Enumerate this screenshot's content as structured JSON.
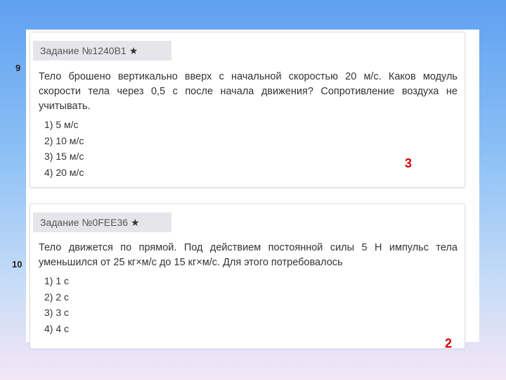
{
  "slide": {
    "question_numbers": [
      "9",
      "10"
    ],
    "answers": [
      "3",
      "2"
    ]
  },
  "tasks": [
    {
      "header": "Задание №1240B1",
      "star": "★",
      "text": "Тело брошено вертикально вверх с начальной скоростью 20 м/с. Каков модуль скорости тела через 0,5 с после начала движения? Сопротивление воздуха не учитывать.",
      "options": [
        "1) 5 м/с",
        "2) 10 м/с",
        "3) 15 м/с",
        "4) 20 м/с"
      ]
    },
    {
      "header": "Задание №0FEE36",
      "star": "★",
      "text": "Тело движется по прямой. Под действием постоянной силы  5 Н импульс тела уменьшился от 25 кг×м/с до 15 кг×м/с. Для этого потребовалось",
      "options": [
        "1) 1 с",
        "2) 2 с",
        "3) 3 с",
        "4) 4 с"
      ]
    }
  ],
  "colors": {
    "answer": "#d40000",
    "header_bg": "#e6e5ea",
    "background_top": "#5fa0f0",
    "background_bottom": "#f3e6f5"
  }
}
